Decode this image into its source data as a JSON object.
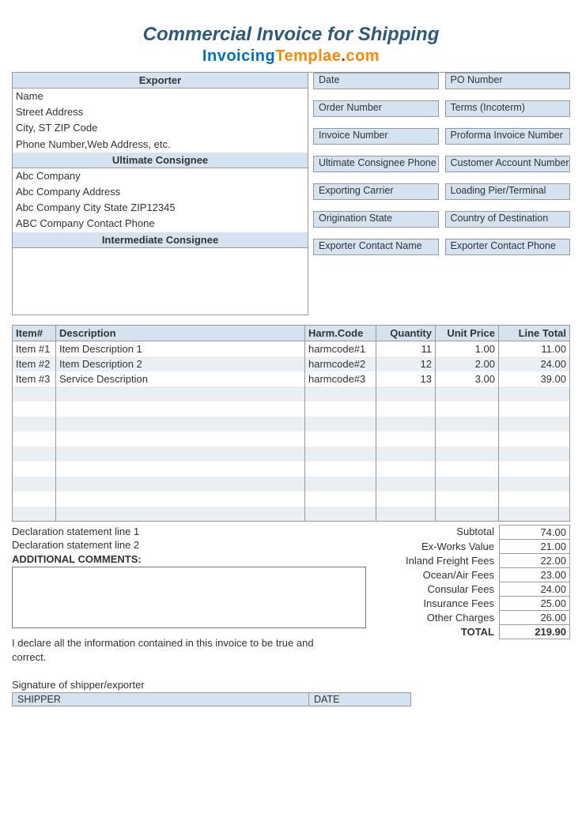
{
  "header": {
    "title": "Commercial Invoice for Shipping",
    "logo": {
      "part1": "Invoicing",
      "part2": "Templae",
      "dot": ".",
      "tld": "com"
    }
  },
  "exporter": {
    "heading": "Exporter",
    "name": "Name",
    "street": "Street Address",
    "city_line": "City, ST  ZIP Code",
    "contact_line": "Phone Number,Web Address, etc."
  },
  "ultimate": {
    "heading": "Ultimate Consignee",
    "company": "Abc Company",
    "address": "Abc Company Address",
    "city_line": "Abc Company City State ZIP12345",
    "phone": "ABC Company Contact Phone"
  },
  "intermediate": {
    "heading": "Intermediate Consignee"
  },
  "labels": [
    "Date",
    "PO Number",
    "Order Number",
    "Terms (Incoterm)",
    "Invoice Number",
    "Proforma Invoice Number",
    "Ultimate Consignee Phone",
    "Customer Account Number",
    "Exporting Carrier",
    "Loading Pier/Terminal",
    "Origination State",
    "Country of Destination",
    "Exporter Contact Name",
    "Exporter Contact Phone"
  ],
  "items": {
    "columns": {
      "item": "Item#",
      "desc": "Description",
      "harm": "Harm.Code",
      "qty": "Quantity",
      "price": "Unit Price",
      "total": "Line Total"
    },
    "rows": [
      {
        "item": "Item #1",
        "desc": "Item Description 1",
        "harm": "harmcode#1",
        "qty": "11",
        "price": "1.00",
        "total": "11.00"
      },
      {
        "item": "Item #2",
        "desc": "Item Description 2",
        "harm": "harmcode#2",
        "qty": "12",
        "price": "2.00",
        "total": "24.00"
      },
      {
        "item": "Item #3",
        "desc": "Service Description",
        "harm": "harmcode#3",
        "qty": "13",
        "price": "3.00",
        "total": "39.00"
      }
    ],
    "blank_rows": 9
  },
  "declarations": {
    "line1": "Declaration statement line 1",
    "line2": "Declaration statement line 2",
    "additional_label": "ADDITIONAL COMMENTS:",
    "declare": "I declare all the information contained in this invoice to be true and correct."
  },
  "totals": [
    {
      "label": "Subtotal",
      "value": "74.00"
    },
    {
      "label": "Ex-Works Value",
      "value": "21.00"
    },
    {
      "label": "Inland Freight Fees",
      "value": "22.00"
    },
    {
      "label": "Ocean/Air Fees",
      "value": "23.00"
    },
    {
      "label": "Consular Fees",
      "value": "24.00"
    },
    {
      "label": "Insurance Fees",
      "value": "25.00"
    },
    {
      "label": "Other Charges",
      "value": "26.00"
    },
    {
      "label": "TOTAL",
      "value": "219.90",
      "bold": true
    }
  ],
  "signature": {
    "line": "Signature of shipper/exporter",
    "shipper_label": "SHIPPER",
    "date_label": "DATE"
  }
}
